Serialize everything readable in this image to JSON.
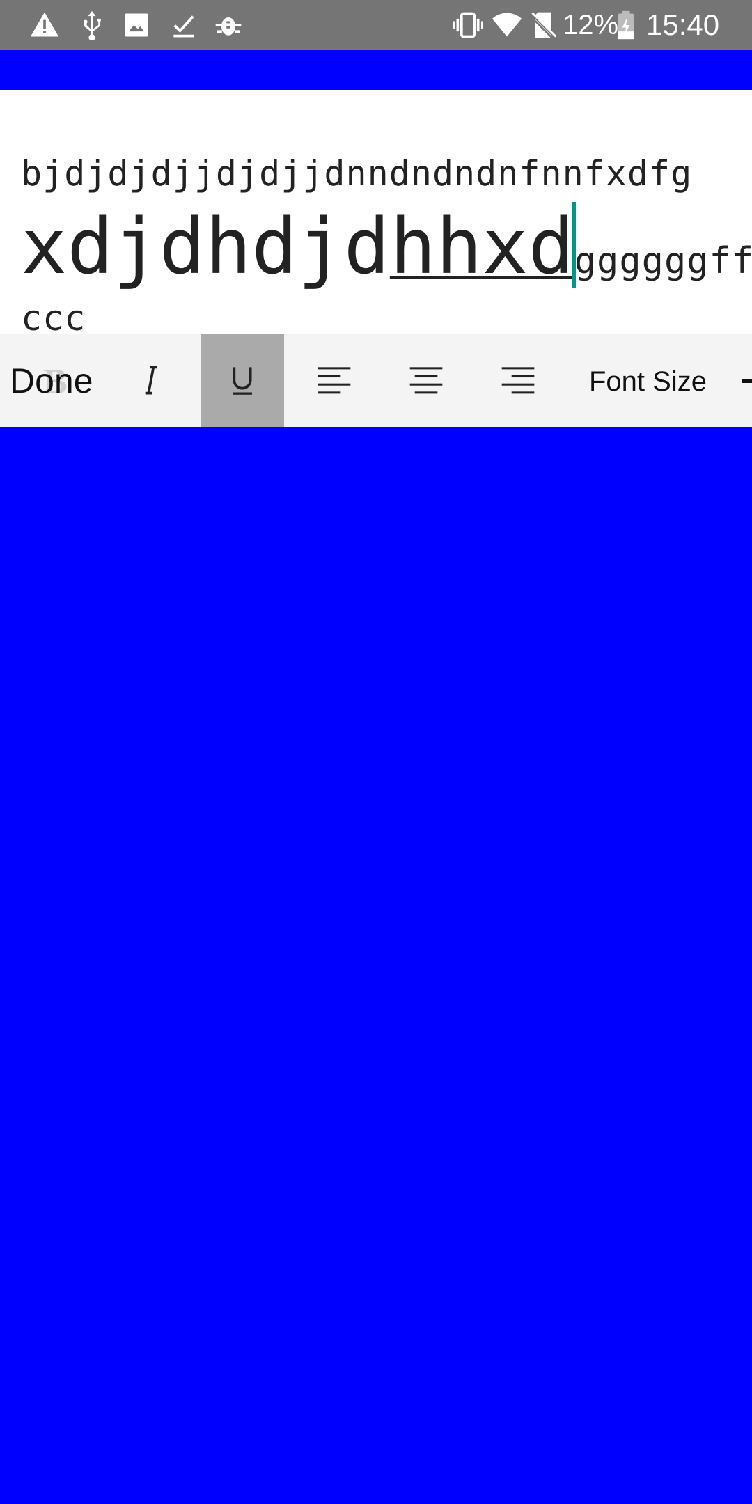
{
  "status_bar": {
    "icons": [
      "alert-icon",
      "usb-icon",
      "image-icon",
      "download-done-icon",
      "bug-icon",
      "vibrate-icon",
      "wifi-icon",
      "no-sim-icon",
      "battery-charging-icon"
    ],
    "battery_percent": "12%",
    "time": "15:40"
  },
  "editor": {
    "line1": "bjdjdjdjjdjdjjdnndndndnfnnfxdfg",
    "line2_part1": "xdjdhdjd",
    "line2_underlined": "hhxd",
    "line2_small": "ggggggff",
    "line3": "ccc"
  },
  "toolbar": {
    "done_label": "Done",
    "bold_label": "B",
    "font_size_label": "Font Size",
    "active_tool": "underline"
  },
  "colors": {
    "background": "#0000ff",
    "status_bar": "#757575",
    "toolbar_bg": "#f4f4f4",
    "active_tool_bg": "#aaaaaa",
    "cursor": "#009688"
  }
}
